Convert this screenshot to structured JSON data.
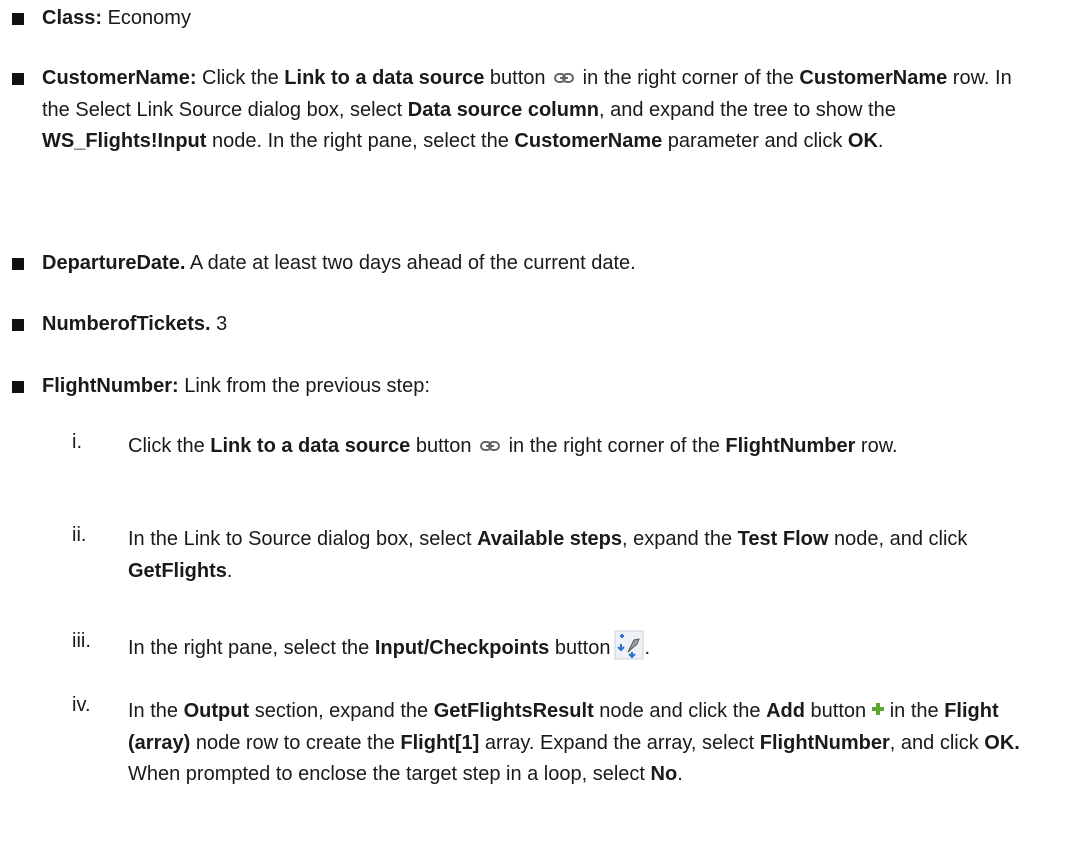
{
  "bullets": [
    {
      "label": "Class:",
      "text": " Economy"
    },
    {
      "label": "CustomerName:",
      "t1": " Click the ",
      "b1": "Link to a data source",
      "t2": " button ",
      "icon": "link-icon",
      "t3": " in the right corner of the ",
      "b2": "CustomerName",
      "t4": " row. In the Select Link Source dialog box, select ",
      "b3": "Data source column",
      "t5": ", and expand the tree to show the ",
      "b4": "WS_Flights!Input",
      "t6": " node. In the right pane, select the ",
      "b5": "CustomerName",
      "t7": " parameter and click ",
      "b6": "OK",
      "t8": "."
    },
    {
      "label": "DepartureDate.",
      "text": " A date at least two days ahead of the current date."
    },
    {
      "label": "NumberofTickets.",
      "text": " 3"
    },
    {
      "label": "FlightNumber:",
      "text": " Link from the previous step:"
    }
  ],
  "substeps": [
    {
      "numeral": "i.",
      "t1": "Click the ",
      "b1": "Link to a data source",
      "t2": " button ",
      "icon": "link-icon",
      "t3": " in the right corner of the ",
      "b2": "FlightNumber",
      "t4": " row."
    },
    {
      "numeral": "ii.",
      "t1": "In the Link to Source dialog box, select ",
      "b1": "Available steps",
      "t2": ", expand the ",
      "b2": "Test Flow",
      "t3": " node, and click ",
      "b3": "GetFlights",
      "t4": "."
    },
    {
      "numeral": "iii.",
      "t1": "In the right pane, select the ",
      "b1": "Input/Checkpoints",
      "t2": " button",
      "icon": "input-checkpoints-icon",
      "t3": "."
    },
    {
      "numeral": "iv.",
      "t1": "In the ",
      "b1": "Output",
      "t2": " section, expand the ",
      "b2": "GetFlightsResult",
      "t3": " node and click the ",
      "b3": "Add",
      "t4": " button",
      "icon": "add-icon",
      "t5": " in the ",
      "b4": "Flight (array)",
      "t6": " node row to create the ",
      "b5": "Flight[1]",
      "t7": " array. Expand the array, select ",
      "b6": "FlightNumber",
      "t8": ", and click ",
      "b7": "OK.",
      "t9": " When prompted to enclose the target step in a loop, select ",
      "b8": "No",
      "t10": "."
    }
  ]
}
